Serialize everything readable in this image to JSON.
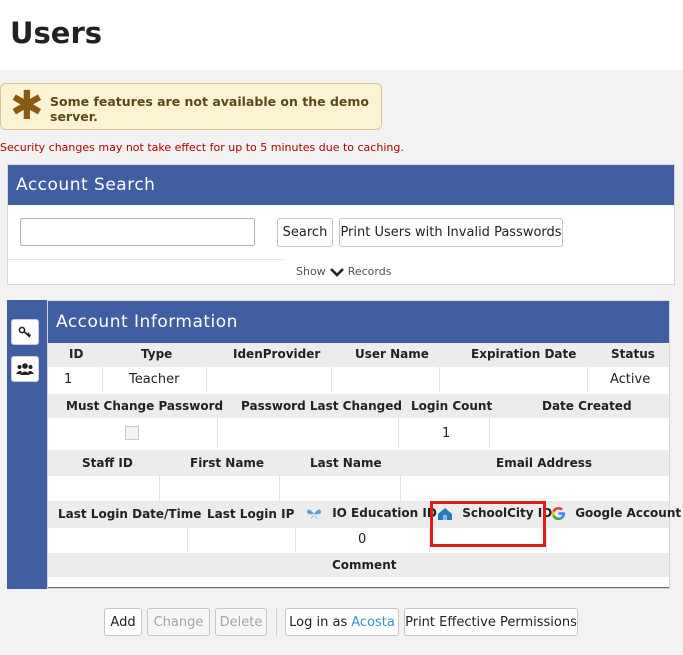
{
  "page": {
    "title": "Users"
  },
  "notice": {
    "text": "Some features are not available on the demo server."
  },
  "warning": {
    "text": "Security changes may not take effect for up to 5 minutes due to caching."
  },
  "account_search": {
    "title": "Account Search",
    "input_value": "",
    "search_label": "Search",
    "invalid_passwords_label": "Print Users with Invalid Passwords",
    "show_label": "Show",
    "records_label": "Records"
  },
  "account_info": {
    "title": "Account Information",
    "row1": {
      "headers": [
        "ID",
        "Type",
        "IdenProvider",
        "User Name",
        "Expiration Date",
        "Status"
      ],
      "values": [
        "1",
        "Teacher",
        "",
        "",
        "",
        "Active"
      ]
    },
    "row2": {
      "headers": [
        "Must Change Password",
        "Password Last Changed",
        "Login Count",
        "Date Created"
      ],
      "values": [
        "",
        "",
        "1",
        ""
      ]
    },
    "row3": {
      "headers": [
        "Staff ID",
        "First Name",
        "Last Name",
        "Email Address"
      ],
      "values": [
        "",
        "",
        "",
        ""
      ]
    },
    "row4": {
      "headers": [
        "Last Login Date/Time",
        "Last Login IP",
        "IO Education ID",
        "SchoolCity ID",
        "Google Account"
      ],
      "values": [
        "",
        "",
        "0",
        "",
        ""
      ]
    },
    "row5": {
      "headers": [
        "Comment"
      ],
      "values": [
        ""
      ]
    }
  },
  "actions": {
    "add_label": "Add",
    "change_label": "Change",
    "delete_label": "Delete",
    "login_as_label": "Log in as",
    "login_as_user": "Acosta",
    "print_permissions_label": "Print Effective Permissions"
  },
  "colors": {
    "header_blue": "#3f5fa2",
    "notice_bg": "#fcf3d2",
    "warning_red": "#b00000",
    "highlight_red": "#e01b1b"
  },
  "icons": {
    "notice": "asterisk-icon",
    "show_toggle": "chevron-down-icon",
    "side_tab_1": "key-icon",
    "side_tab_2": "users-group-icon",
    "io_education": "butterfly-icon",
    "schoolcity": "schoolcity-house-icon",
    "google": "google-g-icon"
  }
}
